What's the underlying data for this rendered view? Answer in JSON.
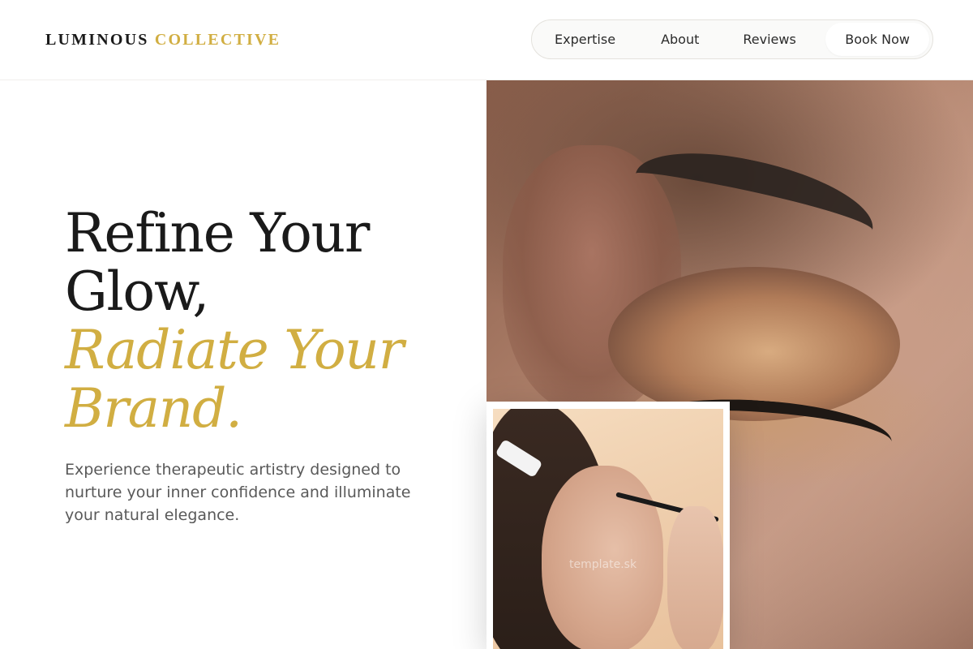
{
  "brand": {
    "name_part1": "LUMINOUS",
    "name_part2": "COLLECTIVE"
  },
  "nav": {
    "items": [
      {
        "label": "Expertise"
      },
      {
        "label": "About"
      },
      {
        "label": "Reviews"
      },
      {
        "label": "Book Now"
      }
    ]
  },
  "hero": {
    "title_line1": "Refine Your",
    "title_line2": "Glow,",
    "title_line3": "Radiate Your",
    "title_line4": "Brand.",
    "subtitle": "Experience therapeutic artistry designed to nurture your inner confidence and illuminate your natural elegance."
  },
  "images": {
    "main_alt": "Close-up of eye with bronze eyeshadow makeup",
    "inset_alt": "Makeup artist applying eyeshadow with a brush",
    "inset_watermark": "template.sk"
  },
  "colors": {
    "accent": "#d1ae42",
    "text": "#1a1a1a",
    "muted": "#595959"
  }
}
